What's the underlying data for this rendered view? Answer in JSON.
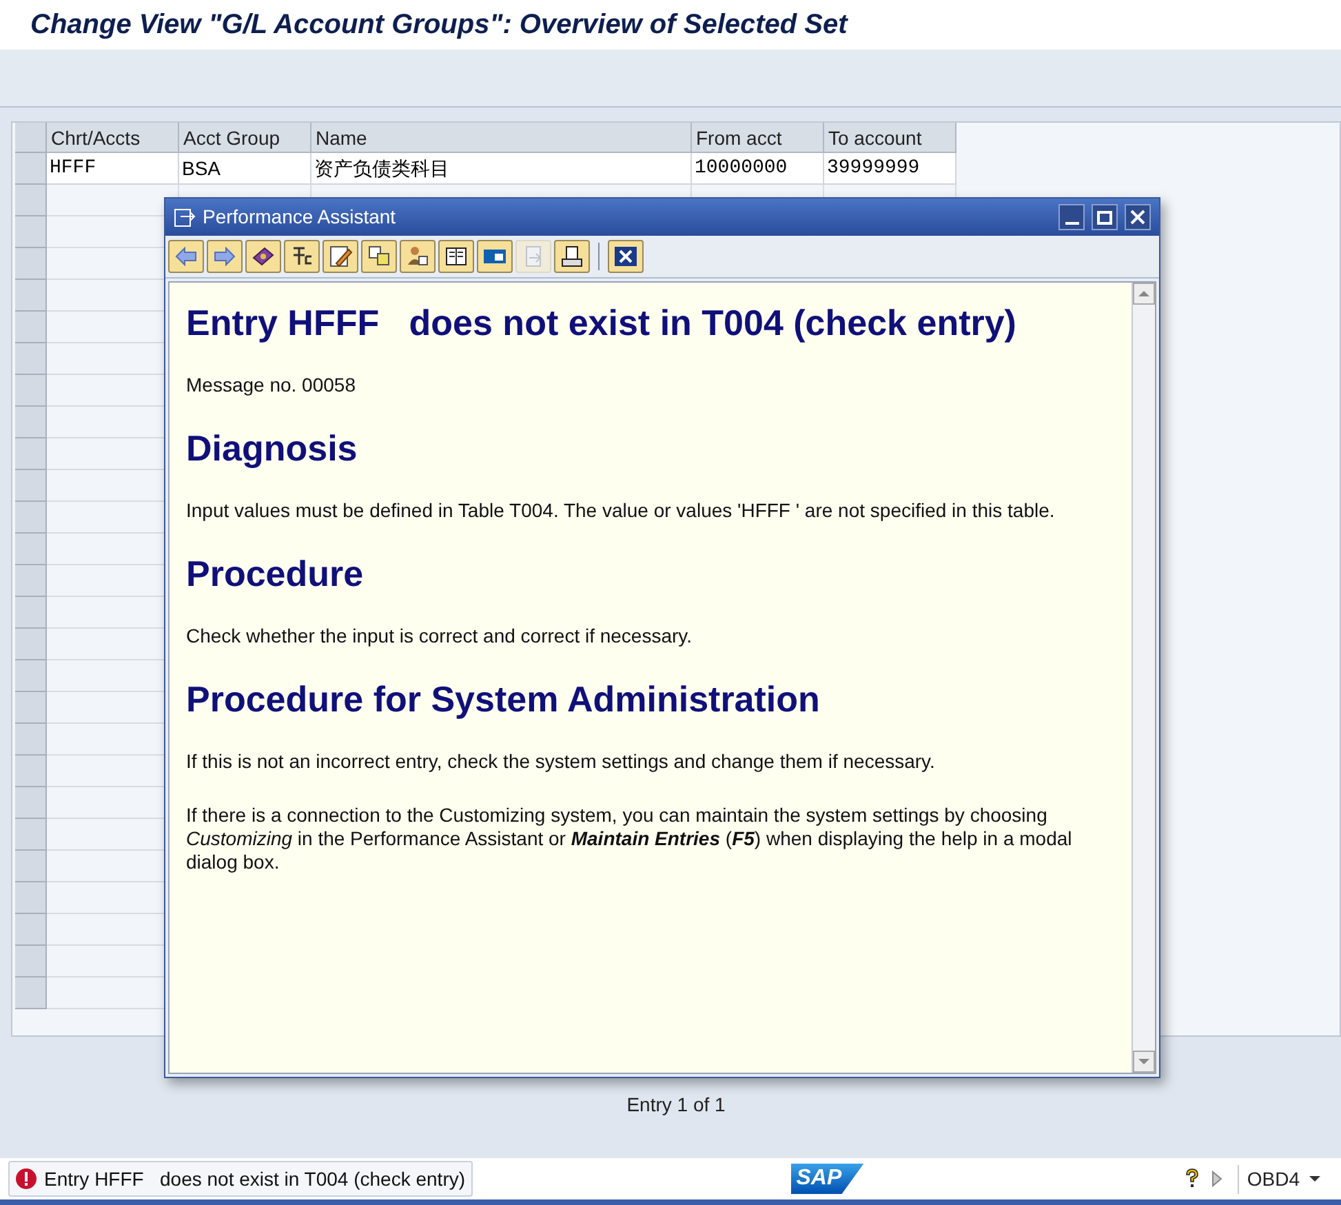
{
  "title": "Change View \"G/L Account Groups\": Overview of Selected Set",
  "table": {
    "columns": [
      "Chrt/Accts",
      "Acct Group",
      "Name",
      "From acct",
      "To account"
    ],
    "rows": [
      [
        "HFFF",
        "BSA",
        "资产负债类科目",
        "10000000",
        "39999999"
      ]
    ]
  },
  "dialog": {
    "title": "Performance Assistant",
    "toolbar": [
      {
        "kind": "back",
        "disabled": false
      },
      {
        "kind": "forward",
        "disabled": false
      },
      {
        "kind": "book",
        "disabled": false
      },
      {
        "kind": "tech",
        "disabled": false
      },
      {
        "kind": "edit",
        "disabled": false
      },
      {
        "kind": "notes",
        "disabled": false
      },
      {
        "kind": "person",
        "disabled": false
      },
      {
        "kind": "table",
        "disabled": false
      },
      {
        "kind": "window",
        "disabled": false
      },
      {
        "kind": "export",
        "disabled": true
      },
      {
        "kind": "print",
        "disabled": false
      },
      {
        "kind": "close",
        "disabled": false
      }
    ],
    "content": [
      {
        "kind": "heading",
        "text": "Entry HFFF   does not exist in T004 (check entry)"
      },
      {
        "kind": "paragraph",
        "text": "Message no. 00058"
      },
      {
        "kind": "heading",
        "text": "Diagnosis"
      },
      {
        "kind": "paragraph",
        "text": "Input values must be defined in Table T004. The value or values 'HFFF  ' are not specified in this table."
      },
      {
        "kind": "heading",
        "text": "Procedure"
      },
      {
        "kind": "paragraph",
        "text": "Check whether the input is correct and correct if necessary."
      },
      {
        "kind": "heading",
        "text": "Procedure for System Administration"
      },
      {
        "kind": "paragraph",
        "text": "If this is not an incorrect entry, check the system settings and change them if necessary."
      },
      {
        "kind": "paragraph",
        "text": "If there is a connection to the Customizing system, you can maintain the system settings by choosing *Customizing* in the Performance Assistant or **Maintain Entries** (**F5**) when displaying the help in a modal dialog box."
      }
    ]
  },
  "entry_count": "Entry 1 of 1",
  "status_bar": {
    "message": "Entry HFFF   does not exist in T004 (check entry)",
    "logo": "SAP",
    "system": "OBD4"
  }
}
